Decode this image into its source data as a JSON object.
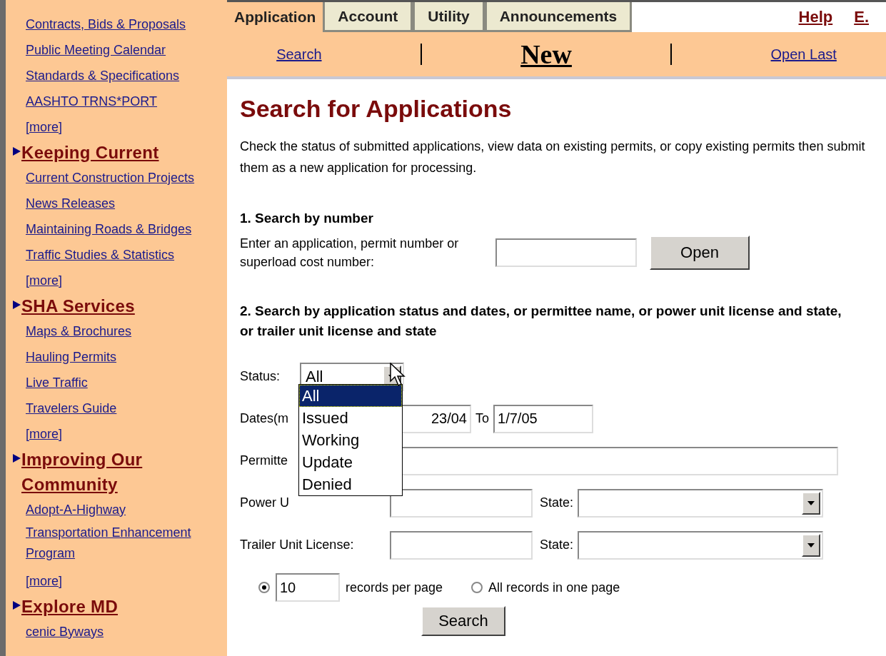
{
  "sidebar": {
    "sections": [
      {
        "items": [
          "Contracts, Bids & Proposals",
          "Public Meeting Calendar",
          "Standards & Specifications",
          "AASHTO TRNS*PORT",
          "[more]"
        ]
      },
      {
        "title": "Keeping Current",
        "items": [
          "Current Construction Projects",
          "News Releases",
          "Maintaining Roads & Bridges",
          "Traffic Studies & Statistics",
          "[more]"
        ]
      },
      {
        "title": "SHA Services",
        "items": [
          "Maps & Brochures",
          "Hauling Permits",
          "Live Traffic",
          "Travelers Guide",
          "[more]"
        ]
      },
      {
        "title": "Improving Our Community",
        "items": [
          "Adopt-A-Highway",
          "Transportation Enhancement Program",
          "[more]"
        ]
      },
      {
        "title": "Explore MD",
        "items": [
          "cenic Byways"
        ]
      }
    ]
  },
  "tabs": [
    {
      "label": "Application",
      "selected": true
    },
    {
      "label": "Account",
      "selected": false
    },
    {
      "label": "Utility",
      "selected": false
    },
    {
      "label": "Announcements",
      "selected": false
    }
  ],
  "header_links": [
    "Help",
    "E."
  ],
  "subnav": [
    {
      "label": "Search",
      "selected": false
    },
    {
      "label": "New",
      "selected": true
    },
    {
      "label": "Open Last",
      "selected": false
    }
  ],
  "title": "Search for Applications",
  "intro": "Check the status of submitted applications, view data on existing permits, or copy existing permits then submit them as a new application for processing.",
  "section1": {
    "heading": "1. Search by number",
    "label": "Enter an application, permit number or superload cost number:",
    "button": "Open"
  },
  "section2": {
    "heading": "2. Search by application status and dates, or permittee name, or power unit license and state, or trailer unit license and state",
    "status": {
      "label": "Status:",
      "value": "All",
      "options": [
        {
          "label": "All",
          "selected": true
        },
        {
          "label": "Issued",
          "selected": false
        },
        {
          "label": "Working",
          "selected": false
        },
        {
          "label": "Update",
          "selected": false
        },
        {
          "label": "Denied",
          "selected": false
        }
      ]
    },
    "dates": {
      "label": "Dates(m",
      "from": "23/04",
      "to_label": "To",
      "to": "1/7/05"
    },
    "permittee": {
      "label": "Permitte"
    },
    "power": {
      "label": "Power U",
      "state_label": "State:"
    },
    "trailer": {
      "label": "Trailer Unit License:",
      "state_label": "State:"
    },
    "paging": [
      {
        "kind": "count",
        "selected": true,
        "value": "10",
        "label": "records per page"
      },
      {
        "kind": "all",
        "selected": false,
        "label": "All records in one page"
      }
    ],
    "button": "Search"
  }
}
